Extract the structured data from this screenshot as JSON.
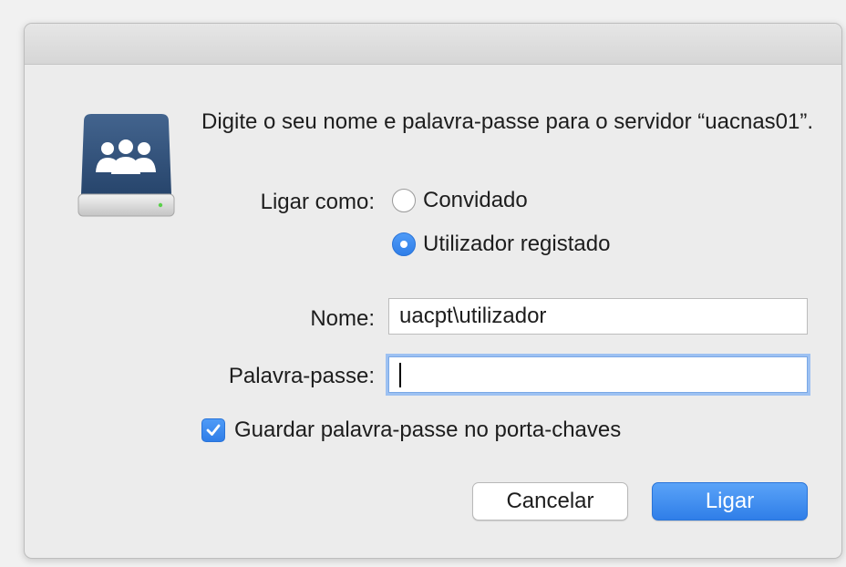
{
  "dialog": {
    "message": "Digite o seu nome e palavra-passe para o servidor “uacnas01”.",
    "server_icon": "network-server-users-icon"
  },
  "connect_as": {
    "label": "Ligar como:",
    "options": [
      {
        "label": "Convidado",
        "selected": false
      },
      {
        "label": "Utilizador registado",
        "selected": true
      }
    ]
  },
  "name_field": {
    "label": "Nome:",
    "value": "uacpt\\utilizador"
  },
  "password_field": {
    "label": "Palavra-passe:",
    "value": ""
  },
  "remember": {
    "label": "Guardar palavra-passe no porta-chaves",
    "checked": true
  },
  "buttons": {
    "cancel": "Cancelar",
    "connect": "Ligar"
  },
  "colors": {
    "accent": "#2f7ee8",
    "dialog_bg": "#ececec"
  }
}
